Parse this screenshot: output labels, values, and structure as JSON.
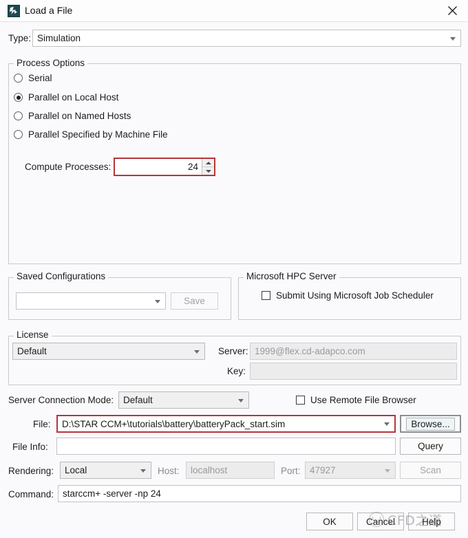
{
  "window": {
    "title": "Load a File",
    "icon": "star-ccm-app-icon",
    "close_icon": "close-icon"
  },
  "type_row": {
    "label": "Type:",
    "value": "Simulation"
  },
  "process_options": {
    "group_title": "Process Options",
    "radios": [
      {
        "label": "Serial",
        "selected": false
      },
      {
        "label": "Parallel on Local Host",
        "selected": true
      },
      {
        "label": "Parallel on Named Hosts",
        "selected": false
      },
      {
        "label": "Parallel Specified by Machine File",
        "selected": false
      }
    ],
    "compute_processes": {
      "label": "Compute Processes:",
      "value": "24",
      "highlight_color": "#b5353a"
    }
  },
  "saved_configurations": {
    "group_title": "Saved Configurations",
    "combo_value": "",
    "save_label": "Save"
  },
  "hpc_server": {
    "group_title": "Microsoft HPC Server",
    "checkbox_label": "Submit Using Microsoft Job Scheduler",
    "checked": false
  },
  "license": {
    "group_title": "License",
    "combo_value": "Default",
    "server_label": "Server:",
    "server_value": "1999@flex.cd-adapco.com",
    "key_label": "Key:",
    "key_value": ""
  },
  "server_connection": {
    "label": "Server Connection Mode:",
    "value": "Default",
    "remote_browser_label": "Use Remote File Browser",
    "remote_browser_checked": false
  },
  "file_row": {
    "label": "File:",
    "value": "D:\\STAR CCM+\\tutorials\\battery\\batteryPack_start.sim",
    "browse_label": "Browse...",
    "highlight_color": "#b5353a"
  },
  "file_info_row": {
    "label": "File Info:",
    "value": "",
    "query_label": "Query"
  },
  "rendering_row": {
    "label": "Rendering:",
    "value": "Local",
    "host_label": "Host:",
    "host_value": "localhost",
    "port_label": "Port:",
    "port_value": "47927",
    "scan_label": "Scan"
  },
  "command_row": {
    "label": "Command:",
    "value": "starccm+ -server -np 24"
  },
  "footer": {
    "ok_label": "OK",
    "cancel_label": "Cancel",
    "help_label": "Help"
  },
  "watermark": {
    "text": "CFD之道"
  }
}
